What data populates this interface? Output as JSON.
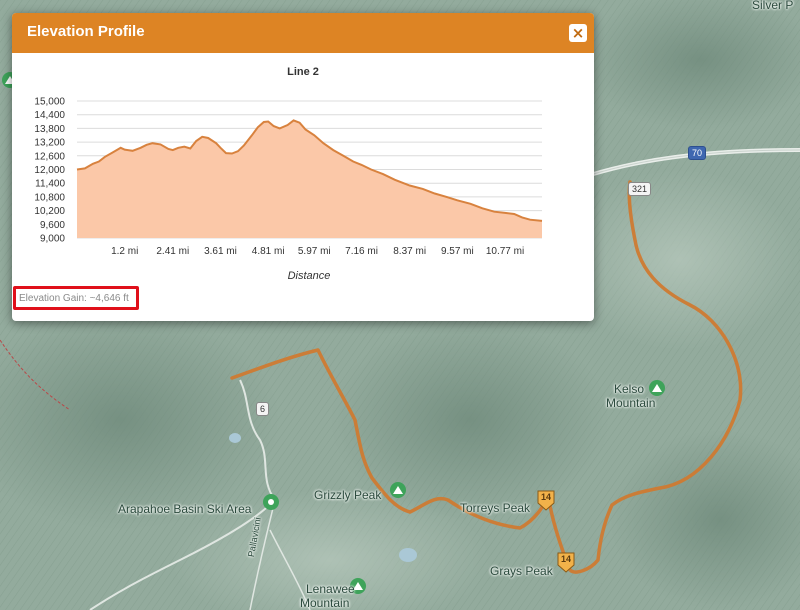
{
  "popup": {
    "title": "Elevation Profile",
    "close_symbol": "×",
    "elevation_gain": "Elevation Gain: ~4,646 ft"
  },
  "map": {
    "labels": {
      "kelso_1": "Kelso",
      "kelso_2": "Mountain",
      "torreys": "Torreys Peak",
      "grizzly": "Grizzly Peak",
      "grays": "Grays Peak",
      "arapahoe": "Arapahoe Basin Ski Area",
      "lenawee_1": "Lenawee",
      "lenawee_2": "Mountain",
      "silver_1": "Silver P",
      "pallavicini": "Pallavicini",
      "road_6": "6",
      "road_70": "70",
      "road_321": "321",
      "marker_a": "14",
      "marker_b": "14"
    },
    "route_color": "#d07b2f",
    "peak_icon_color": "#3ea35a"
  },
  "chart_data": {
    "type": "area",
    "title": "Line 2",
    "xlabel": "Distance",
    "ylabel": "",
    "x_ticks": [
      "1.2 mi",
      "2.41 mi",
      "3.61 mi",
      "4.81 mi",
      "5.97 mi",
      "7.16 mi",
      "8.37 mi",
      "9.57 mi",
      "10.77 mi"
    ],
    "y_ticks": [
      "15,000",
      "14,400",
      "13,800",
      "13,200",
      "12,600",
      "12,000",
      "11,400",
      "10,800",
      "10,200",
      "9,600",
      "9,000"
    ],
    "ylim": [
      9000,
      15000
    ],
    "xlim": [
      0,
      11.7
    ],
    "grid": true,
    "fill_color": "#fbc8a8",
    "line_color": "#d8823e",
    "x": [
      0,
      0.2,
      0.4,
      0.55,
      0.7,
      0.9,
      1.1,
      1.2,
      1.4,
      1.6,
      1.75,
      1.9,
      2.1,
      2.3,
      2.41,
      2.55,
      2.7,
      2.85,
      3.0,
      3.15,
      3.3,
      3.5,
      3.61,
      3.75,
      3.9,
      4.05,
      4.2,
      4.4,
      4.55,
      4.7,
      4.81,
      4.95,
      5.1,
      5.3,
      5.45,
      5.6,
      5.75,
      5.97,
      6.2,
      6.45,
      6.7,
      6.95,
      7.16,
      7.4,
      7.7,
      8.0,
      8.37,
      8.7,
      9.0,
      9.3,
      9.57,
      9.9,
      10.2,
      10.5,
      10.77,
      11.0,
      11.2,
      11.4,
      11.7
    ],
    "y": [
      12000,
      12050,
      12250,
      12350,
      12550,
      12750,
      12950,
      12870,
      12820,
      12950,
      13080,
      13150,
      13100,
      12900,
      12850,
      12950,
      13000,
      12920,
      13250,
      13430,
      13380,
      13150,
      12950,
      12720,
      12700,
      12800,
      13050,
      13500,
      13850,
      14080,
      14100,
      13900,
      13800,
      13950,
      14150,
      14050,
      13750,
      13500,
      13150,
      12850,
      12600,
      12350,
      12200,
      12000,
      11800,
      11550,
      11300,
      11150,
      10950,
      10800,
      10650,
      10500,
      10300,
      10150,
      10100,
      10050,
      9900,
      9800,
      9750
    ]
  }
}
